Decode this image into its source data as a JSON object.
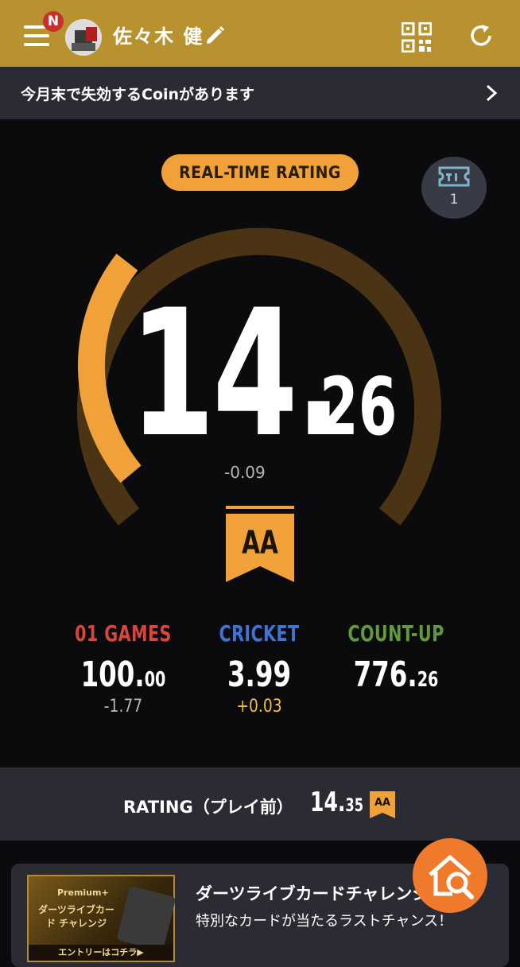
{
  "header": {
    "notification_badge": "N",
    "username": "佐々木 健"
  },
  "notice": {
    "text": "今月末で失効するCoinがあります"
  },
  "realtime": {
    "label": "REAL-TIME RATING",
    "ticket_count": "1",
    "rating_integer": "14.",
    "rating_decimal": "26",
    "delta": "-0.09",
    "rank": "AA",
    "gauge_fraction": 0.3
  },
  "stats": [
    {
      "title": "01 GAMES",
      "value_int": "100.",
      "value_dec": "00",
      "delta": "-1.77",
      "title_color": "#d9453a",
      "delta_color": "#b5b5b5"
    },
    {
      "title": "CRICKET",
      "value_int": "3.99",
      "value_dec": "",
      "delta": "+0.03",
      "title_color": "#3f74d6",
      "delta_color": "#f0c040"
    },
    {
      "title": "COUNT-UP",
      "value_int": "776.",
      "value_dec": "26",
      "delta": "",
      "title_color": "#5f9a3d",
      "delta_color": "#b5b5b5"
    }
  ],
  "rating_before": {
    "label": "RATING（プレイ前）",
    "value_int": "14.",
    "value_dec": "35",
    "rank": "AA"
  },
  "banner": {
    "image_premium": "Premium+",
    "image_title": "ダーツライブカード チャレンジ",
    "image_entry": "エントリーはコチラ▶",
    "title": "ダーツライブカードチャレンジ",
    "subtitle": "特別なカードが当たるラストチャンス！"
  },
  "colors": {
    "header": "#b8922e",
    "accent": "#f0a13a",
    "gauge_track": "#4a3414",
    "fab": "#f07a2c"
  }
}
